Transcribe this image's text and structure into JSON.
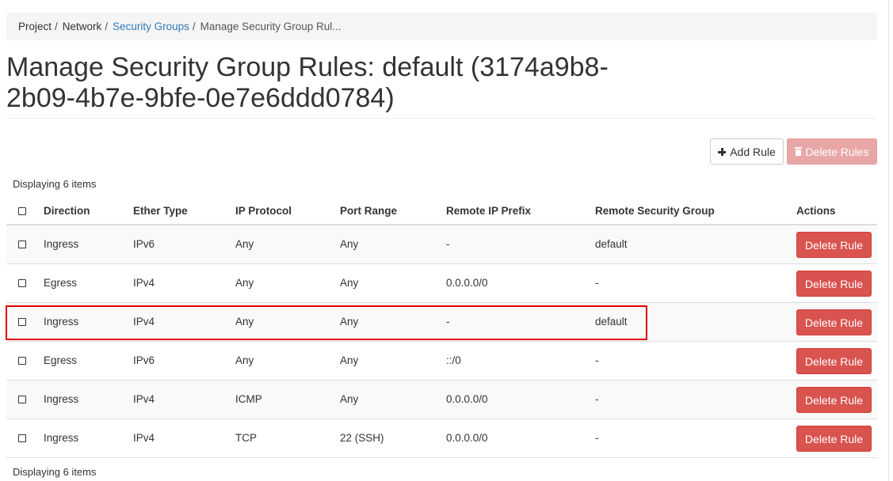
{
  "breadcrumb": {
    "items": [
      {
        "label": "Project",
        "kind": "plain"
      },
      {
        "label": "Network",
        "kind": "plain"
      },
      {
        "label": "Security Groups",
        "kind": "link"
      },
      {
        "label": "Manage Security Group Rul...",
        "kind": "active"
      }
    ],
    "separator": "/"
  },
  "page": {
    "title": "Manage Security Group Rules: default (3174a9b8-2b09-4b7e-9bfe-0e7e6ddd0784)"
  },
  "toolbar": {
    "add_rule_label": "Add Rule",
    "add_rule_icon": "plus-icon",
    "delete_rules_label": "Delete Rules",
    "delete_rules_icon": "trash-icon",
    "delete_rules_disabled": true
  },
  "table": {
    "count_text_top": "Displaying 6 items",
    "count_text_bottom": "Displaying 6 items",
    "columns": [
      "Direction",
      "Ether Type",
      "IP Protocol",
      "Port Range",
      "Remote IP Prefix",
      "Remote Security Group",
      "Actions"
    ],
    "rows": [
      {
        "direction": "Ingress",
        "ether_type": "IPv6",
        "ip_protocol": "Any",
        "port_range": "Any",
        "remote_ip_prefix": "-",
        "remote_security_group": "default",
        "action_label": "Delete Rule"
      },
      {
        "direction": "Egress",
        "ether_type": "IPv4",
        "ip_protocol": "Any",
        "port_range": "Any",
        "remote_ip_prefix": "0.0.0.0/0",
        "remote_security_group": "-",
        "action_label": "Delete Rule"
      },
      {
        "direction": "Ingress",
        "ether_type": "IPv4",
        "ip_protocol": "Any",
        "port_range": "Any",
        "remote_ip_prefix": "-",
        "remote_security_group": "default",
        "action_label": "Delete Rule",
        "highlighted": true
      },
      {
        "direction": "Egress",
        "ether_type": "IPv6",
        "ip_protocol": "Any",
        "port_range": "Any",
        "remote_ip_prefix": "::/0",
        "remote_security_group": "-",
        "action_label": "Delete Rule"
      },
      {
        "direction": "Ingress",
        "ether_type": "IPv4",
        "ip_protocol": "ICMP",
        "port_range": "Any",
        "remote_ip_prefix": "0.0.0.0/0",
        "remote_security_group": "-",
        "action_label": "Delete Rule"
      },
      {
        "direction": "Ingress",
        "ether_type": "IPv4",
        "ip_protocol": "TCP",
        "port_range": "22 (SSH)",
        "remote_ip_prefix": "0.0.0.0/0",
        "remote_security_group": "-",
        "action_label": "Delete Rule"
      }
    ]
  },
  "colors": {
    "link": "#337ab7",
    "danger": "#d9534f",
    "danger_disabled": "#e8a7a6",
    "highlight": "#e00000"
  }
}
